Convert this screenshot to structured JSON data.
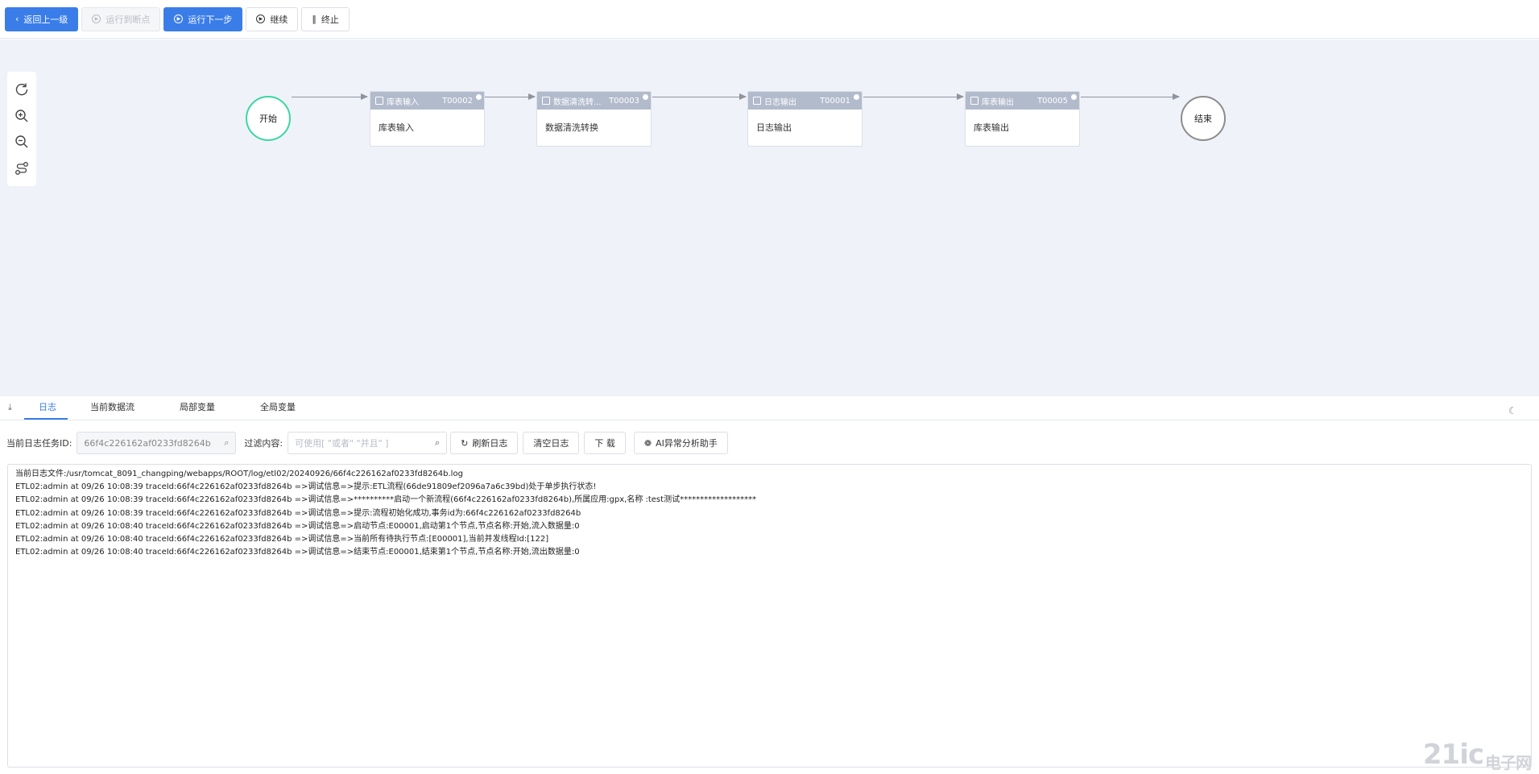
{
  "toolbar": {
    "back": "返回上一级",
    "run_to_breakpoint": "运行到断点",
    "run_next": "运行下一步",
    "continue": "继续",
    "stop": "终止"
  },
  "flow": {
    "start": "开始",
    "end": "结束",
    "nodes": [
      {
        "name": "库表输入",
        "code": "T00002",
        "body": "库表输入"
      },
      {
        "name": "数据清洗转...",
        "code": "T00003",
        "body": "数据清洗转换"
      },
      {
        "name": "日志输出",
        "code": "T00001",
        "body": "日志输出"
      },
      {
        "name": "库表输出",
        "code": "T00005",
        "body": "库表输出"
      }
    ]
  },
  "tabs": {
    "log": "日志",
    "current_stream": "当前数据流",
    "local_vars": "局部变量",
    "global_vars": "全局变量"
  },
  "filter": {
    "task_id_label": "当前日志任务ID:",
    "task_id_value": "66f4c226162af0233fd8264b",
    "content_label": "过滤内容:",
    "content_placeholder": "可使用[ \"或者\" \"并且\" ]",
    "refresh": "刷新日志",
    "clear": "清空日志",
    "download": "下 载",
    "ai": "AI异常分析助手"
  },
  "log_lines": [
    "当前日志文件:/usr/tomcat_8091_changping/webapps/ROOT/log/etl02/20240926/66f4c226162af0233fd8264b.log",
    "ETL02:admin at 09/26 10:08:39 traceId:66f4c226162af0233fd8264b =>调试信息=>提示:ETL流程(66de91809ef2096a7a6c39bd)处于单步执行状态!",
    "ETL02:admin at 09/26 10:08:39 traceId:66f4c226162af0233fd8264b =>调试信息=>**********启动一个新流程(66f4c226162af0233fd8264b),所属应用:gpx,名称 :test测试*******************",
    "ETL02:admin at 09/26 10:08:39 traceId:66f4c226162af0233fd8264b =>调试信息=>提示:流程初始化成功,事务id为:66f4c226162af0233fd8264b",
    "ETL02:admin at 09/26 10:08:40 traceId:66f4c226162af0233fd8264b =>调试信息=>启动节点:E00001,启动第1个节点,节点名称:开始,流入数据量:0",
    "ETL02:admin at 09/26 10:08:40 traceId:66f4c226162af0233fd8264b =>调试信息=>当前所有待执行节点:[E00001],当前并发线程Id:[122]",
    "ETL02:admin at 09/26 10:08:40 traceId:66f4c226162af0233fd8264b =>调试信息=>结束节点:E00001,结束第1个节点,节点名称:开始,流出数据量:0"
  ],
  "watermark": {
    "main": "21ic",
    "sub": "电子网"
  }
}
